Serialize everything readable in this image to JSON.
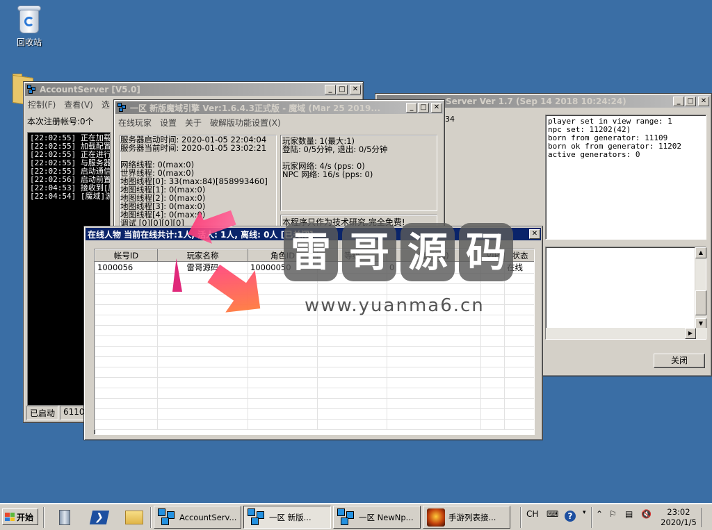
{
  "desktop": {
    "recycle_bin_label": "回收站"
  },
  "account_window": {
    "title": "AccountServer [V5.0]",
    "menu": [
      "控制(F)",
      "查看(V)",
      "选"
    ],
    "registered_label": "本次注册帐号:0个",
    "log": [
      "[22:02:55] 正在加载数",
      "[22:02:55] 加载配置文",
      "[22:02:55] 正在进行数",
      "[22:02:55] 与服务器数",
      "[22:02:55] 启动通信引",
      "[22:02:56] 启动前置服",
      "[22:04:53] 接收到[魔域",
      "[22:04:54] [魔域]游戏"
    ],
    "status": [
      "已启动",
      "6110"
    ]
  },
  "npc_window": {
    "title": "Server Ver 1.7 (Sep 14 2018 10:24:24)",
    "left_value": "34",
    "info_lines": [
      "player set in view range: 1",
      "npc set: 11202(42)",
      "born from generator: 11109",
      "born ok from generator: 11202",
      "active generators: 0"
    ],
    "close_button": "关闭"
  },
  "engine_window": {
    "title": "一区 新版魔域引擎 Ver:1.6.4.3正式版 - 魔域 (Mar 25 2019...",
    "menu": [
      "在线玩家",
      "设置",
      "关于",
      "破解版功能设置(X)"
    ],
    "left_lines": [
      "服务器启动时间: 2020-01-05 22:04:04",
      "服务器当前时间: 2020-01-05 23:02:21",
      "",
      "网络线程:   0(max:0)",
      "世界线程:   0(max:0)",
      "地图线程[0]:  33(max:84)[858993460]",
      "地图线程[1]:   0(max:0)",
      "地图线程[2]:   0(max:0)",
      "地图线程[3]:   0(max:0)",
      "地图线程[4]:   0(max:0)",
      "调试 [0][0][0][0]"
    ],
    "right_lines": [
      "玩家数量:   1(最大:1)",
      "登陆: 0/5分钟, 退出: 0/5分钟",
      "",
      "玩家网络:   4/s (pps: 0)",
      "NPC 网络:  16/s (pps: 0)"
    ],
    "notice": "本程序只作为技术研究,完全免费!"
  },
  "online_window": {
    "title": "在线人物  当前在线共计:1人, 活人: 1人, 离线: 0人 [已关闭]",
    "columns": [
      "帐号ID",
      "玩家名称",
      "角色ID",
      "等级",
      "魔石(晶)",
      "VIP",
      "状态"
    ],
    "rows": [
      [
        "1000056",
        "雷哥源码",
        "10000050",
        "0",
        "0",
        "",
        "在线"
      ]
    ]
  },
  "watermark": {
    "chars": [
      "雷",
      "哥",
      "源",
      "码"
    ],
    "url": "www.yuanma6.cn"
  },
  "taskbar": {
    "start_label": "开始",
    "tasks": [
      "AccountServ...",
      "一区 新版...",
      "一区 NewNp...",
      "手游列表接..."
    ],
    "lang": "CH",
    "time": "23:02",
    "date": "2020/1/5"
  }
}
